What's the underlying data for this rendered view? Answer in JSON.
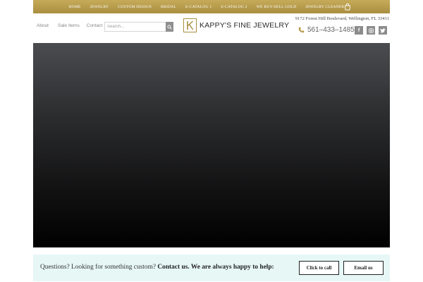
{
  "nav": {
    "items": [
      {
        "label": "HOME"
      },
      {
        "label": "JEWELRY"
      },
      {
        "label": "CUSTOM DESIGN"
      },
      {
        "label": "BRIDAL"
      },
      {
        "label": "E-CATALOG 1"
      },
      {
        "label": "E-CATALOG 2"
      },
      {
        "label": "WE BUY/SELL GOLD"
      },
      {
        "label": "JEWELRY CLEANER"
      }
    ],
    "cart_icon": "shopping-bag-icon"
  },
  "header": {
    "links": [
      {
        "label": "About"
      },
      {
        "label": "Sale Items"
      },
      {
        "label": "Contact"
      }
    ],
    "search": {
      "placeholder": "Search...",
      "value": "",
      "icon": "search-icon"
    },
    "logo": {
      "mark_letter": "K",
      "text": "KAPPY'S FINE JEWELRY"
    },
    "address": "9172 Forest Hill Boulevard, Wellington, FL 33411",
    "phone": {
      "text": "561–433–1485",
      "icon": "phone-icon"
    },
    "socials": [
      {
        "icon": "facebook-icon",
        "glyph": "f"
      },
      {
        "icon": "instagram-icon",
        "glyph": ""
      },
      {
        "icon": "twitter-icon",
        "glyph": ""
      }
    ]
  },
  "cta": {
    "question": "Questions? Looking for something custom?",
    "strong": "Contact us. We are always happy to help:",
    "call_label": "Click to call",
    "email_label": "Email us"
  },
  "colors": {
    "gold": "#b59a4a",
    "cta_background": "#e6f7f6",
    "social_gray": "#8c8c8c"
  }
}
